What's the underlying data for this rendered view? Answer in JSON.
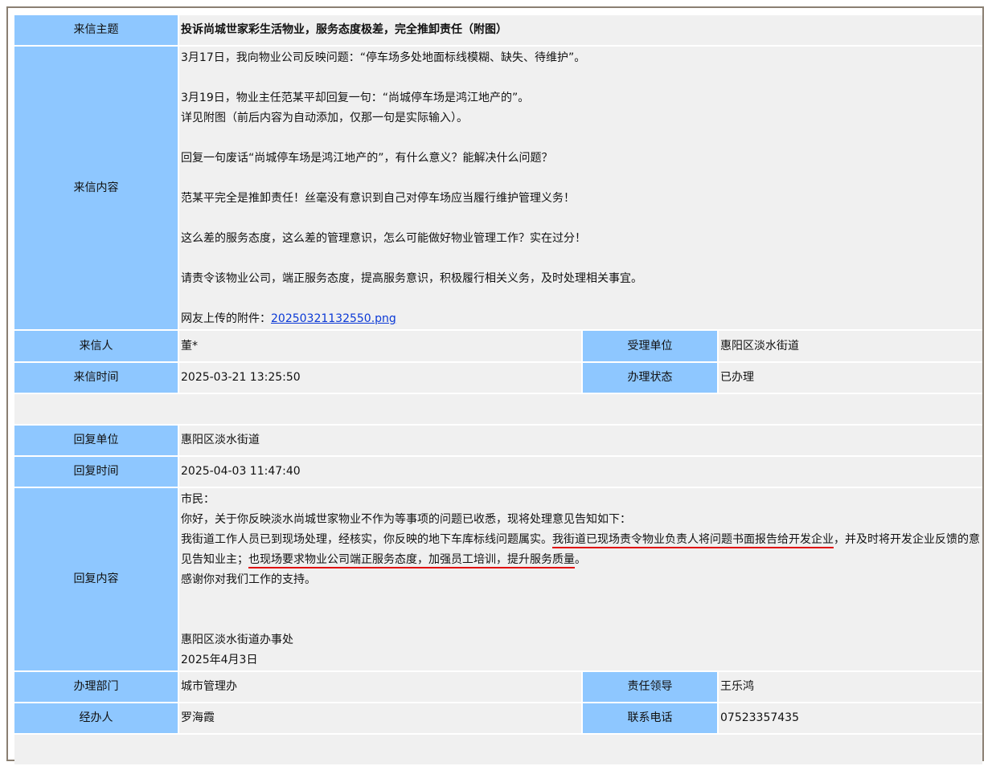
{
  "letter": {
    "subject_label": "来信主题",
    "subject": "投诉尚城世家彩生活物业，服务态度极差，完全推卸责任（附图）",
    "content_label": "来信内容",
    "content": {
      "line1": "3月17日，我向物业公司反映问题：“停车场多处地面标线模糊、缺失、待维护”。",
      "line2": "3月19日，物业主任范某平却回复一句：“尚城停车场是鸿江地产的”。",
      "line3": "详见附图（前后内容为自动添加，仅那一句是实际输入）。",
      "line4": "回复一句废话“尚城停车场是鸿江地产的”，有什么意义？能解决什么问题？",
      "line5": "范某平完全是推卸责任！丝毫没有意识到自己对停车场应当履行维护管理义务！",
      "line6": "这么差的服务态度，这么差的管理意识，怎么可能做好物业管理工作？实在过分！",
      "line7": "请责令该物业公司，端正服务态度，提高服务意识，积极履行相关义务，及时处理相关事宜。",
      "attachment_prefix": "网友上传的附件：",
      "attachment_name": "20250321132550.png"
    },
    "sender_label": "来信人",
    "sender": "董*",
    "receiver_label": "受理单位",
    "receiver": "惠阳区淡水街道",
    "time_label": "来信时间",
    "time": "2025-03-21 13:25:50",
    "status_label": "办理状态",
    "status": "已办理"
  },
  "reply": {
    "unit_label": "回复单位",
    "unit": "惠阳区淡水街道",
    "time_label": "回复时间",
    "time": "2025-04-03 11:47:40",
    "content_label": "回复内容",
    "content": {
      "greeting": "市民：",
      "intro": "你好，关于你反映淡水尚城世家物业不作为等事项的问题已收悉，现将处理意见告知如下：",
      "body_a": "我街道工作人员已到现场处理，经核实，你反映的地下车库标线问题属实。",
      "body_b_underlined": "我街道已现场责令物业负责人将问题书面报告给开发企业",
      "body_c": "，并及时将开发企业反馈的意见告知业主；",
      "body_d_underlined": "也现场要求物业公司端正服务态度，加强员工培训，提升服务质量",
      "body_e": "。",
      "thanks": "感谢你对我们工作的支持。",
      "signature": "惠阳区淡水街道办事处",
      "date": "2025年4月3日"
    },
    "dept_label": "办理部门",
    "dept": "城市管理办",
    "leader_label": "责任领导",
    "leader": "王乐鸿",
    "handler_label": "经办人",
    "handler": "罗海霞",
    "phone_label": "联系电话",
    "phone": "07523357435"
  }
}
